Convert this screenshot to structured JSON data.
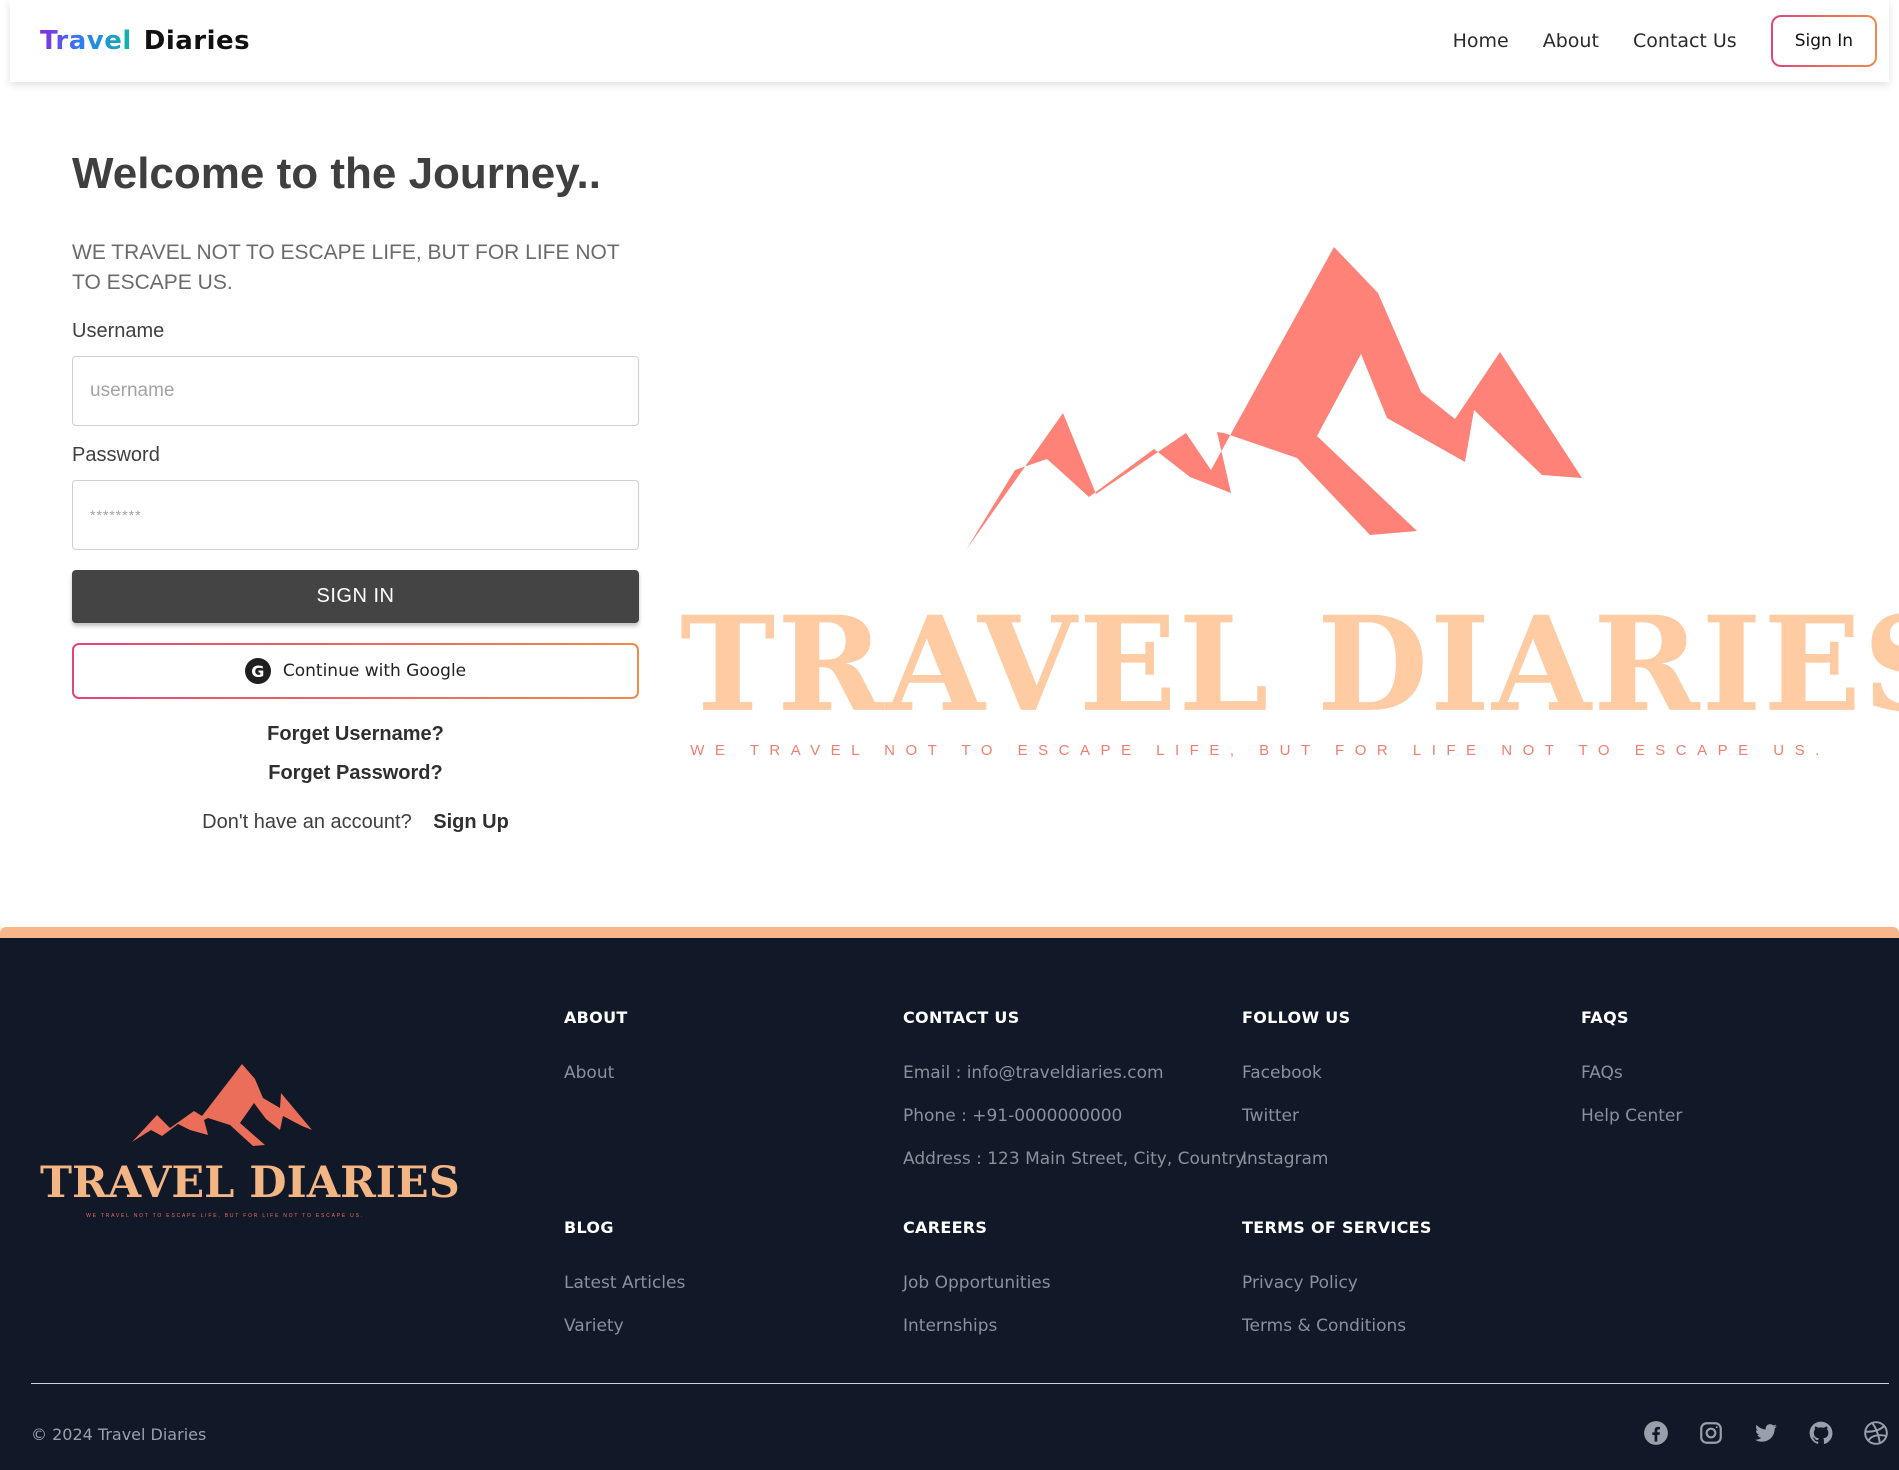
{
  "navbar": {
    "brand_part1": "Travel",
    "brand_part2": "Diaries",
    "links": [
      "Home",
      "About",
      "Contact Us"
    ],
    "signin_label": "Sign In"
  },
  "login": {
    "heading": "Welcome to the Journey..",
    "tagline": "WE TRAVEL NOT TO ESCAPE LIFE, BUT FOR LIFE NOT TO ESCAPE US.",
    "username_label": "Username",
    "username_placeholder": "username",
    "password_label": "Password",
    "password_placeholder": "********",
    "signin_button": "SIGN IN",
    "google_button": "Continue with Google",
    "forgot_username": "Forget Username?",
    "forgot_password": "Forget Password?",
    "no_account_text": "Don't have an account?",
    "signup_link": "Sign Up"
  },
  "hero": {
    "title": "TRAVEL DIARIES",
    "subtitle": "WE TRAVEL NOT TO ESCAPE LIFE, BUT FOR LIFE NOT TO ESCAPE US."
  },
  "footer": {
    "logo_title": "TRAVEL DIARIES",
    "logo_subtitle": "WE TRAVEL NOT TO ESCAPE LIFE, BUT FOR LIFE NOT TO ESCAPE US.",
    "sections": {
      "about": {
        "heading": "ABOUT",
        "items": [
          "About"
        ]
      },
      "contact": {
        "heading": "CONTACT US",
        "items": [
          "Email : info@traveldiaries.com",
          "Phone : +91-0000000000",
          "Address : 123 Main Street, City, Country."
        ]
      },
      "follow": {
        "heading": "FOLLOW US",
        "items": [
          "Facebook",
          "Twitter",
          "Instagram"
        ]
      },
      "faqs": {
        "heading": "FAQS",
        "items": [
          "FAQs",
          "Help Center"
        ]
      },
      "blog": {
        "heading": "BLOG",
        "items": [
          "Latest Articles",
          "Variety"
        ]
      },
      "careers": {
        "heading": "CAREERS",
        "items": [
          "Job Opportunities",
          "Internships"
        ]
      },
      "terms": {
        "heading": "TERMS OF SERVICES",
        "items": [
          "Privacy Policy",
          "Terms & Conditions"
        ]
      }
    },
    "copyright": "© 2024 Travel Diaries",
    "social_icons": [
      "facebook-icon",
      "instagram-icon",
      "twitter-icon",
      "github-icon",
      "dribbble-icon"
    ]
  },
  "colors": {
    "accent_gradient": [
      "#e0457b",
      "#f08a4b"
    ],
    "mountain": "#fe8278",
    "hero_title": "#fecba3",
    "footer_bg": "#111827",
    "footer_border": "#f8b78b",
    "signin_bg": "#444444"
  }
}
